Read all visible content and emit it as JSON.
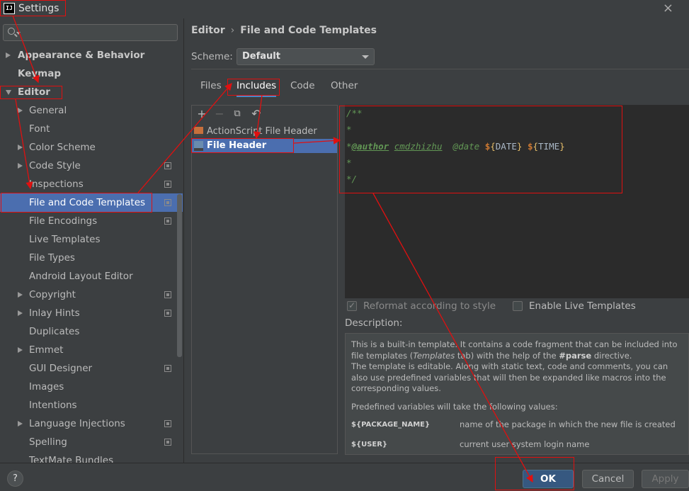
{
  "window": {
    "title": "Settings",
    "app_icon_text": "IJ"
  },
  "sidebar": {
    "search_placeholder": "",
    "items": [
      {
        "label": "Appearance & Behavior",
        "bold": true,
        "arrow": "right",
        "indent": 0
      },
      {
        "label": "Keymap",
        "bold": true,
        "arrow": "",
        "indent": 0
      },
      {
        "label": "Editor",
        "bold": true,
        "arrow": "down",
        "indent": 0
      },
      {
        "label": "General",
        "arrow": "right",
        "indent": 1
      },
      {
        "label": "Font",
        "arrow": "",
        "indent": 1
      },
      {
        "label": "Color Scheme",
        "arrow": "right",
        "indent": 1
      },
      {
        "label": "Code Style",
        "arrow": "right",
        "indent": 1,
        "project": true
      },
      {
        "label": "Inspections",
        "arrow": "",
        "indent": 1,
        "project": true
      },
      {
        "label": "File and Code Templates",
        "arrow": "",
        "indent": 1,
        "project": true,
        "selected": true
      },
      {
        "label": "File Encodings",
        "arrow": "",
        "indent": 1,
        "project": true
      },
      {
        "label": "Live Templates",
        "arrow": "",
        "indent": 1
      },
      {
        "label": "File Types",
        "arrow": "",
        "indent": 1
      },
      {
        "label": "Android Layout Editor",
        "arrow": "",
        "indent": 1
      },
      {
        "label": "Copyright",
        "arrow": "right",
        "indent": 1,
        "project": true
      },
      {
        "label": "Inlay Hints",
        "arrow": "right",
        "indent": 1,
        "project": true
      },
      {
        "label": "Duplicates",
        "arrow": "",
        "indent": 1
      },
      {
        "label": "Emmet",
        "arrow": "right",
        "indent": 1
      },
      {
        "label": "GUI Designer",
        "arrow": "",
        "indent": 1,
        "project": true
      },
      {
        "label": "Images",
        "arrow": "",
        "indent": 1
      },
      {
        "label": "Intentions",
        "arrow": "",
        "indent": 1
      },
      {
        "label": "Language Injections",
        "arrow": "right",
        "indent": 1,
        "project": true
      },
      {
        "label": "Spelling",
        "arrow": "",
        "indent": 1,
        "project": true
      },
      {
        "label": "TextMate Bundles",
        "arrow": "",
        "indent": 1
      }
    ]
  },
  "breadcrumb": {
    "root": "Editor",
    "separator": "›",
    "current": "File and Code Templates"
  },
  "scheme": {
    "label": "Scheme:",
    "value": "Default"
  },
  "tabs": [
    {
      "label": "Files",
      "active": false
    },
    {
      "label": "Includes",
      "active": true
    },
    {
      "label": "Code",
      "active": false
    },
    {
      "label": "Other",
      "active": false
    }
  ],
  "template_list": {
    "toolbar": {
      "add": "+",
      "remove": "−",
      "copy": "⧉",
      "reset": "↶"
    },
    "items": [
      {
        "label": "ActionScript File Header",
        "icon": "actionscript-file-icon",
        "selected": false
      },
      {
        "label": "File Header",
        "icon": "file-icon",
        "selected": true
      }
    ]
  },
  "editor": {
    "lines": {
      "l1": "/**",
      "l2": "*",
      "l3_star": "*",
      "l3_tag": "@author",
      "l3_author": "cmdzhizhu",
      "l3_date_tag": "@date",
      "l3_dollar1": "$",
      "l3_open1": "{",
      "l3_var1": "DATE",
      "l3_close1": "}",
      "l3_dollar2": "$",
      "l3_open2": "{",
      "l3_var2": "TIME",
      "l3_close2": "}",
      "l4": "*",
      "l5": "*/"
    }
  },
  "options": {
    "reformat": {
      "label": "Reformat according to style",
      "checked": true,
      "enabled": false
    },
    "live_templates": {
      "label": "Enable Live Templates",
      "checked": false,
      "enabled": true
    }
  },
  "description": {
    "label": "Description:",
    "p1_a": "This is a built-in template. It contains a code fragment that can be included into file templates (",
    "p1_italic": "Templates",
    "p1_b": " tab) with the help of the ",
    "p1_bold": "#parse",
    "p1_c": " directive.",
    "p1_d": "The template is editable. Along with static text, code and comments, you can also use predefined variables that will then be expanded like macros into the corresponding values.",
    "p2": "Predefined variables will take the following values:",
    "variables": [
      {
        "name": "${PACKAGE_NAME}",
        "desc": "name of the package in which the new file is created"
      },
      {
        "name": "${USER}",
        "desc": "current user system login name"
      }
    ]
  },
  "footer": {
    "help": "?",
    "ok": "OK",
    "cancel": "Cancel",
    "apply": "Apply"
  },
  "colors": {
    "selection": "#4b6eaf",
    "annotation": "#e01010",
    "comment": "#629755",
    "primary_button": "#365880"
  }
}
